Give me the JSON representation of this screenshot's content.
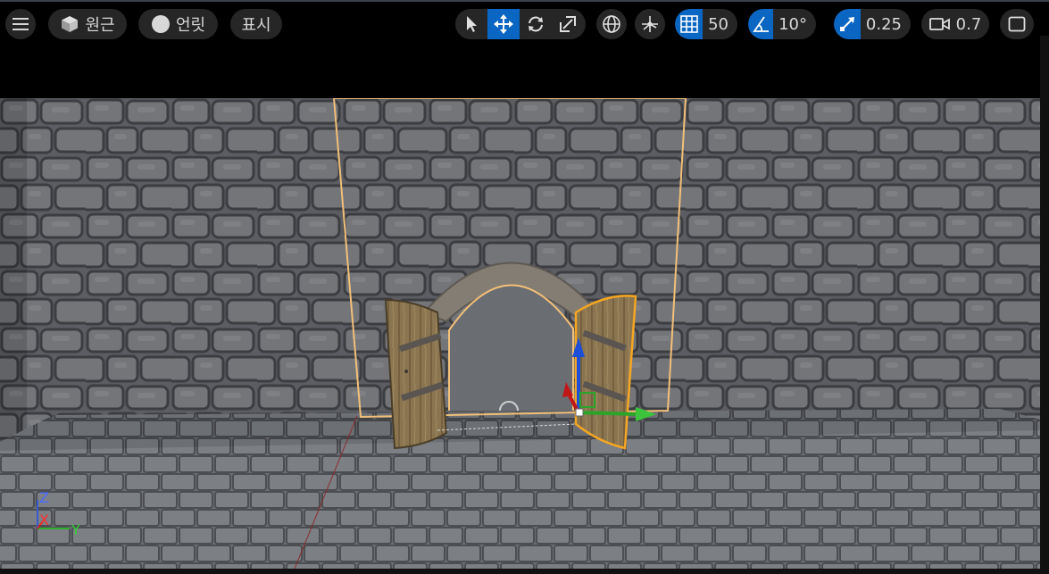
{
  "toolbar": {
    "menu_icon": "hamburger-menu-icon",
    "perspective_label": "원근",
    "lighting_label": "언릿",
    "show_label": "표시",
    "tools": [
      "select-arrow-icon",
      "move-cross-icon",
      "rotate-icon",
      "scale-icon"
    ],
    "active_tool": "move-cross-icon",
    "world_icon": "globe-icon",
    "surface_snap_icon": "surface-snap-icon",
    "grid_snap_value": "50",
    "rotation_snap_value": "10°",
    "scale_snap_value": "0.25",
    "camera_speed_value": "0.7",
    "maximize_icon": "maximize-viewport-icon"
  },
  "axes": {
    "z": "Z",
    "x": "X",
    "y": "Y"
  },
  "colors": {
    "accent": "#0a66c2",
    "pill_bg": "#262626",
    "selection": "#f2c078",
    "selected_door": "#f5a623"
  }
}
